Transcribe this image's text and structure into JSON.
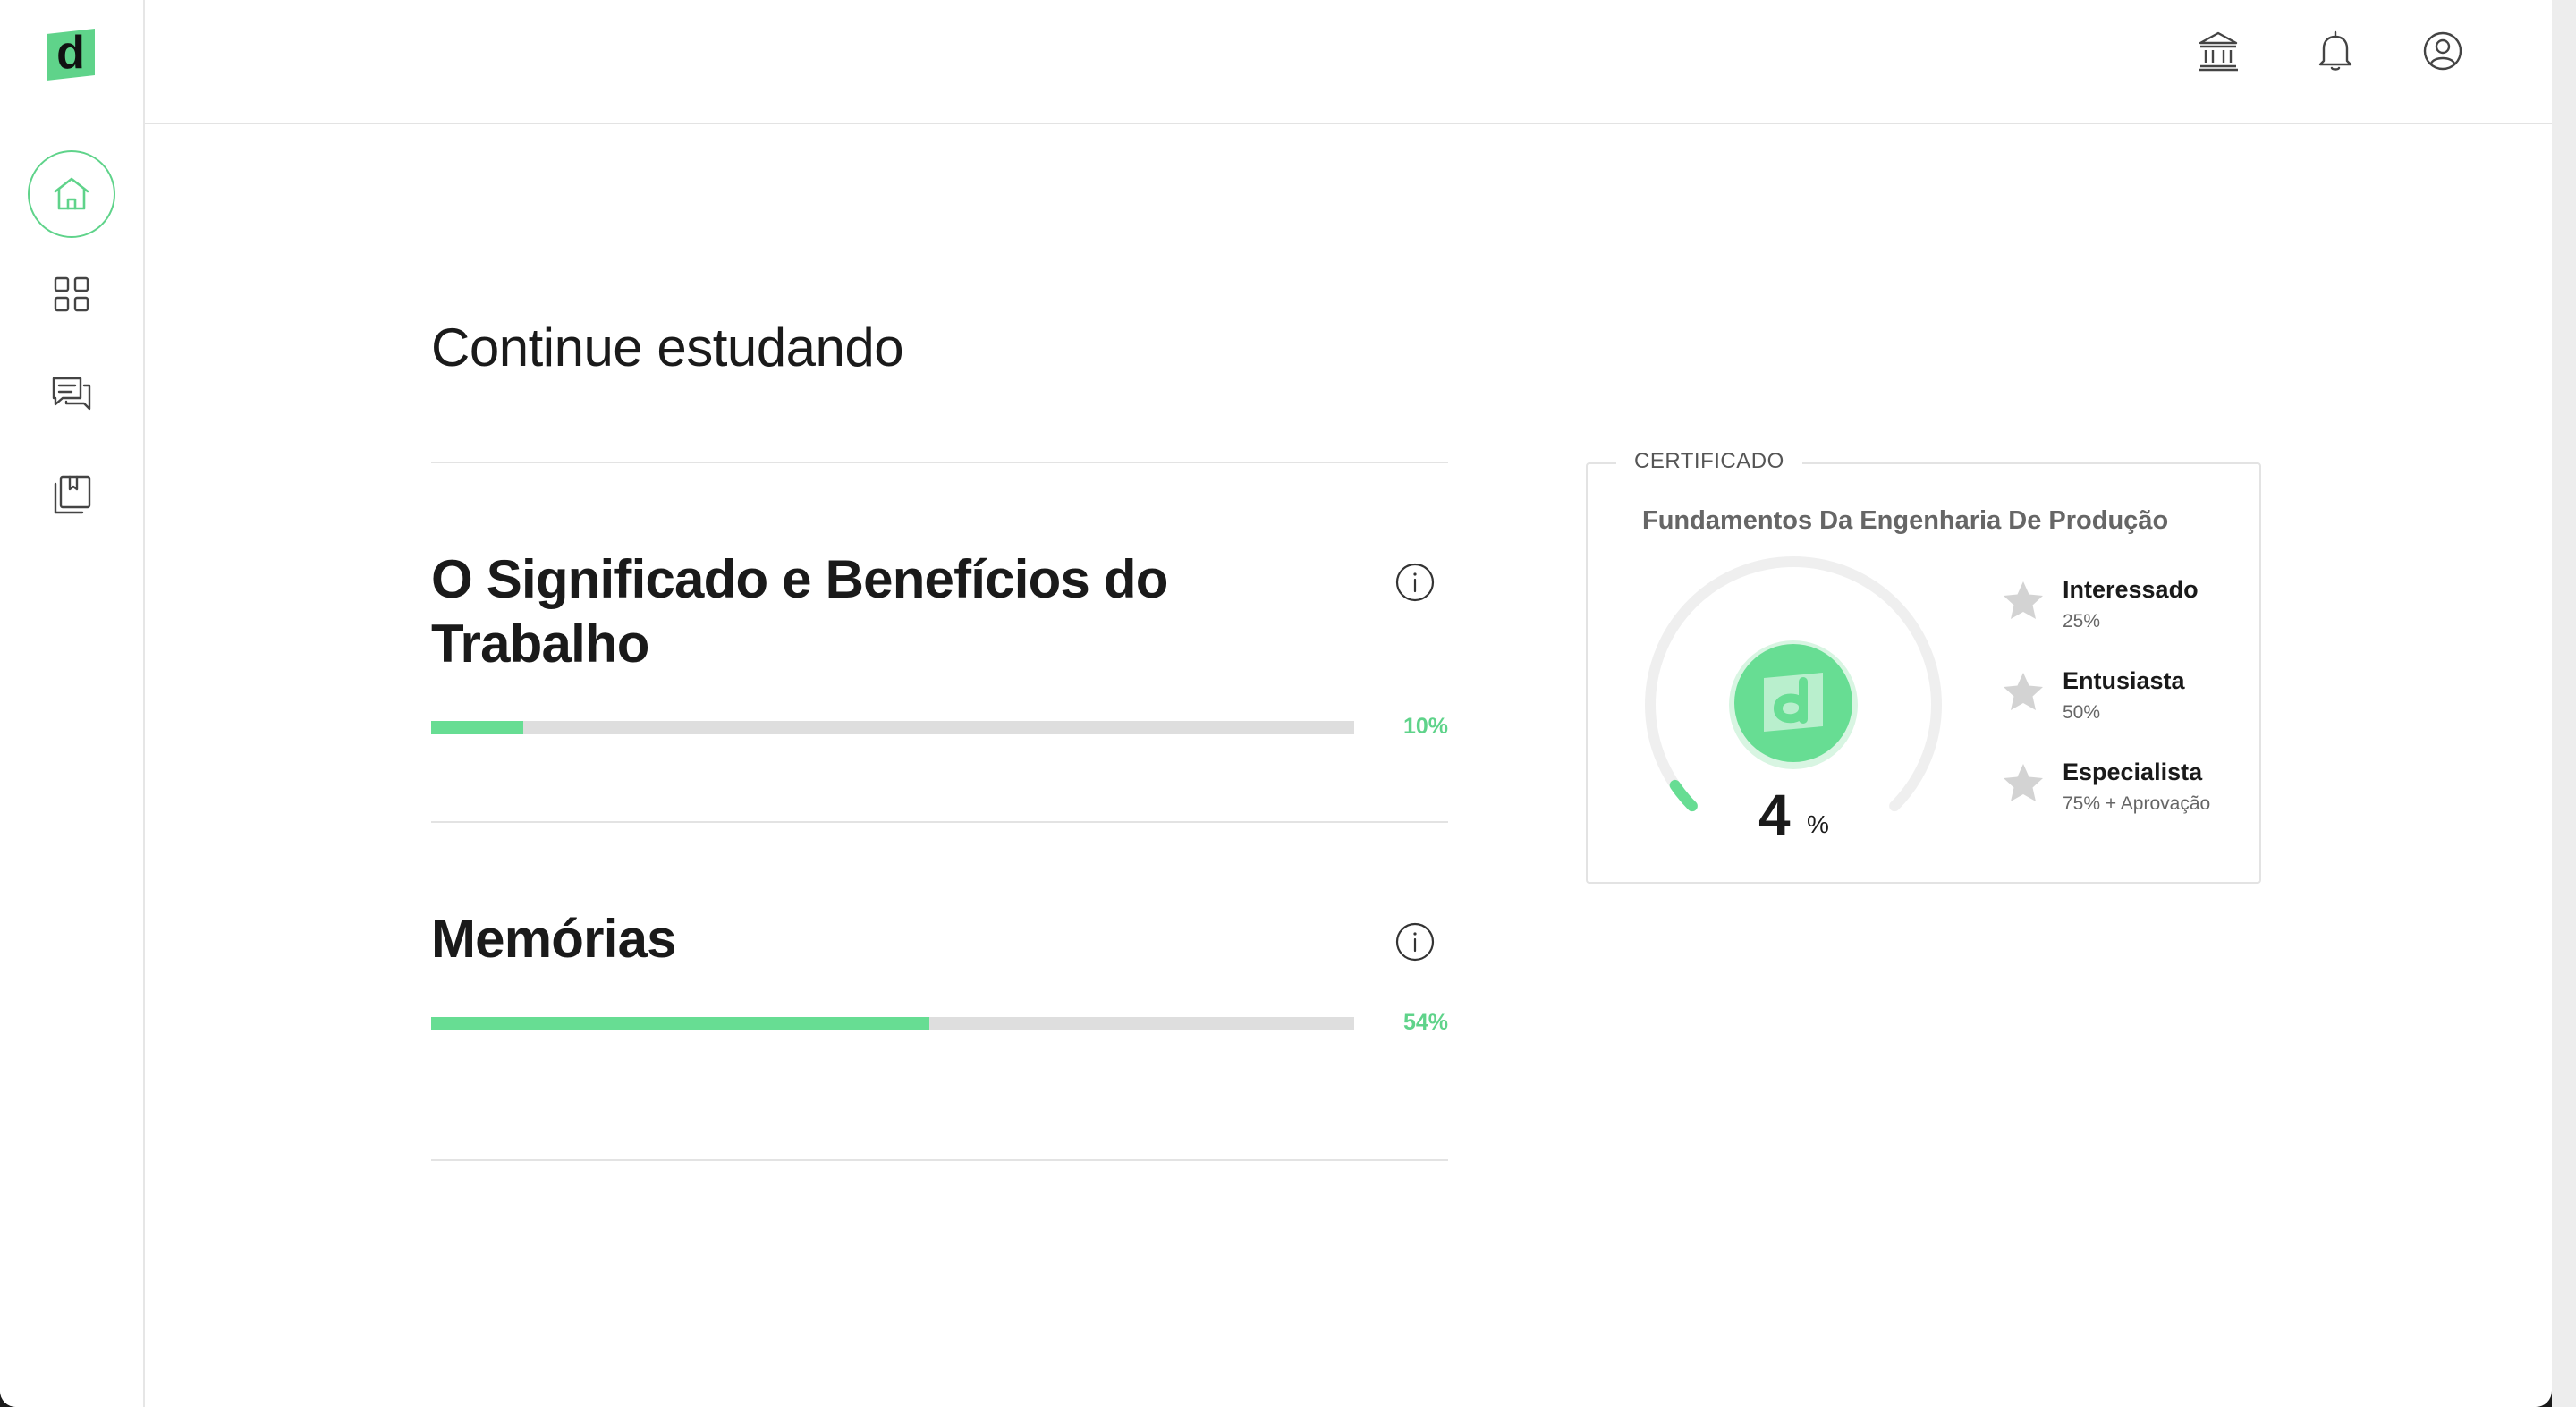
{
  "sidebar": {
    "logo_letter": "d",
    "items": [
      {
        "icon": "home-icon",
        "active": true
      },
      {
        "icon": "grid-icon",
        "active": false
      },
      {
        "icon": "chat-icon",
        "active": false
      },
      {
        "icon": "bookmark-library-icon",
        "active": false
      }
    ]
  },
  "topbar": {
    "icons": [
      "bank-icon",
      "bell-icon",
      "user-icon"
    ]
  },
  "main": {
    "title": "Continue estudando",
    "courses": [
      {
        "title": "O Significado e Benefícios do Trabalho",
        "progress": 0.1,
        "progress_label": "10%"
      },
      {
        "title": "Memórias",
        "progress": 0.54,
        "progress_label": "54%"
      }
    ]
  },
  "certificate": {
    "legend": "CERTIFICADO",
    "course_name": "Fundamentos Da Engenharia De Produção",
    "progress": 0.04,
    "progress_value": "4",
    "progress_unit": "%",
    "levels": [
      {
        "name": "Interessado",
        "requirement": "25%"
      },
      {
        "name": "Entusiasta",
        "requirement": "50%"
      },
      {
        "name": "Especialista",
        "requirement": "75% + Aprovação"
      }
    ]
  },
  "colors": {
    "accent": "#67dd93",
    "accent_text": "#5fd38a",
    "track": "#dedede",
    "star": "#d3d3d3"
  }
}
